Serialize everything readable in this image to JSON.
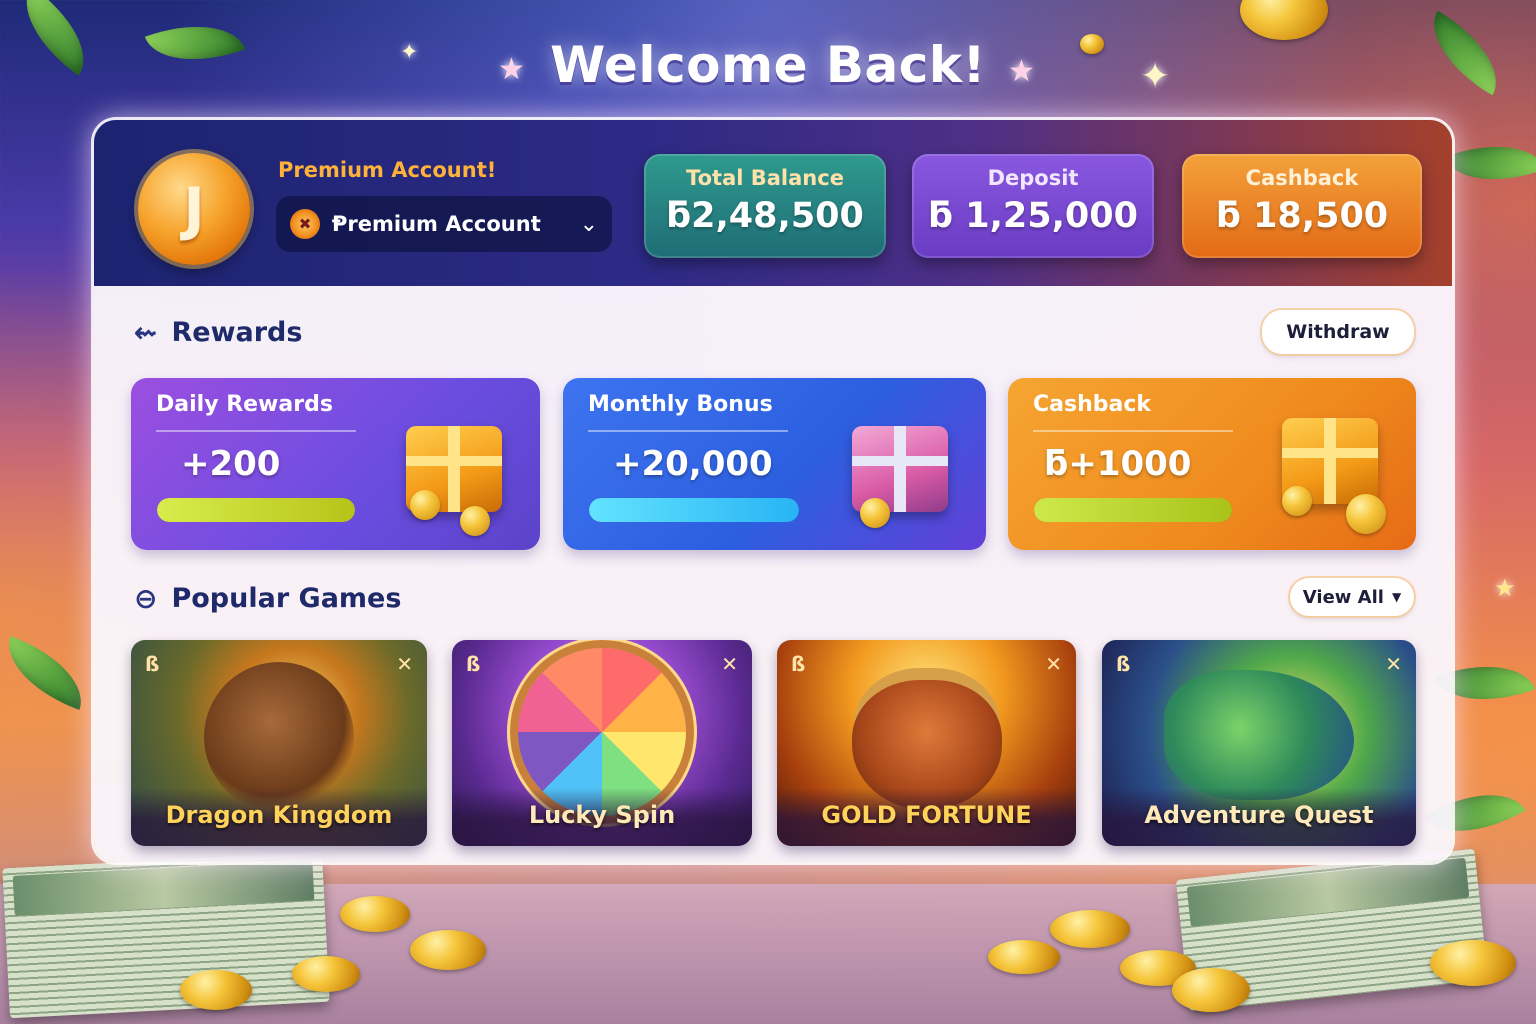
{
  "header": {
    "welcome_title": "Welcome Back!"
  },
  "account": {
    "avatar_letter": "J",
    "tier_title": "Premium Account!",
    "selected_account": "Ᵽremium Account"
  },
  "stats": [
    {
      "label": "Total Balance",
      "value": "ƃ2,48,500"
    },
    {
      "label": "Deposit",
      "value": "ƃ 1,25,000"
    },
    {
      "label": "Cashback",
      "value": "ƃ 18,500"
    }
  ],
  "rewards": {
    "section_title": "Rewards",
    "withdraw_label": "Withdraw",
    "cards": [
      {
        "title": "Daily Rewards",
        "value": "+200",
        "progress_percent": 100
      },
      {
        "title": "Monthly Bonus",
        "value": "+20,000",
        "progress_percent": 100
      },
      {
        "title": "Cashback",
        "value": "ƃ+1000",
        "progress_percent": 100
      }
    ]
  },
  "games": {
    "section_title": "Popular Games",
    "view_all_label": "View All",
    "items": [
      {
        "name": "Dragon Kingdom"
      },
      {
        "name": "Lucky Spin"
      },
      {
        "name": "GOLD FORTUNE"
      },
      {
        "name": "Adventure Quest"
      }
    ]
  },
  "icons": {
    "rewards_icon": "arrow-left-icon",
    "games_icon": "controller-icon",
    "dropdown_icon": "chevron-down-icon",
    "view_all_icon": "caret-down-icon"
  },
  "colors": {
    "accent_orange": "#ffb23a",
    "title_navy": "#1f2a6b",
    "total_balance_bg": "#2f9a8e",
    "deposit_bg": "#8a58e0",
    "cashback_bg": "#f3a13a"
  }
}
